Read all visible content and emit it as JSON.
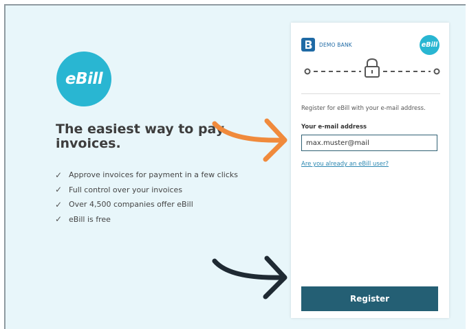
{
  "hero": {
    "logo_text": "eBill",
    "headline": "The easiest way to pay invoices.",
    "features": [
      "Approve invoices for payment in a few clicks",
      "Full control over your invoices",
      "Over 4,500 companies offer eBill",
      "eBill is free"
    ]
  },
  "card": {
    "bank_name": "DEMO BANK",
    "badge_text": "eBill",
    "intro": "Register for eBill with your e-mail address.",
    "email_label": "Your e-mail address",
    "email_value": "max.muster@mail",
    "existing_user_link": "Are you already an eBill user?",
    "register_label": "Register"
  },
  "icons": {
    "check": "check-icon",
    "lock": "lock-icon",
    "bank_logo": "bank-logo-icon",
    "arrows": [
      "orange-arrow-icon",
      "dark-arrow-icon"
    ]
  },
  "colors": {
    "brand_cyan": "#29b6d2",
    "button": "#245f74",
    "page_bg": "#e8f6fa",
    "arrow_orange": "#f08a3c",
    "arrow_dark": "#1f2a33",
    "link": "#2a86b0"
  }
}
